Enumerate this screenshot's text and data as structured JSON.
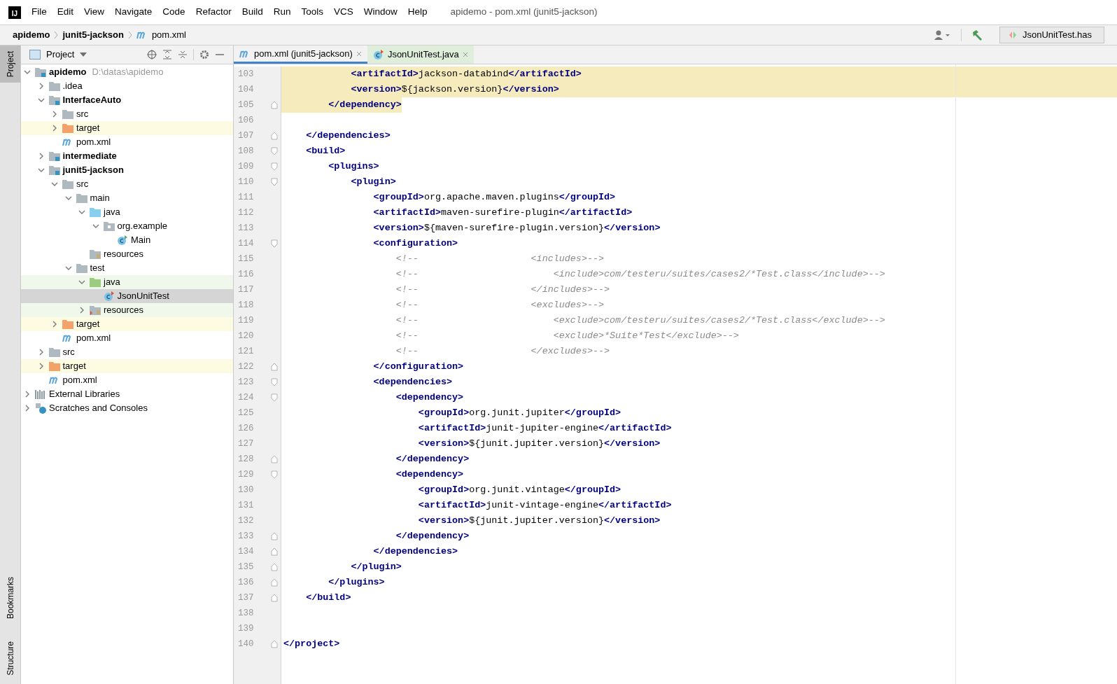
{
  "title_bar": {
    "logo": "IJ",
    "menu": [
      "File",
      "Edit",
      "View",
      "Navigate",
      "Code",
      "Refactor",
      "Build",
      "Run",
      "Tools",
      "VCS",
      "Window",
      "Help"
    ],
    "title": "apidemo - pom.xml (junit5-jackson)"
  },
  "breadcrumb": [
    {
      "label": "apidemo",
      "kind": "project"
    },
    {
      "label": "junit5-jackson",
      "kind": "module"
    },
    {
      "label": "pom.xml",
      "kind": "pom"
    }
  ],
  "run_config": {
    "label": "JsonUnitTest.has"
  },
  "side_tabs": [
    {
      "label": "Project",
      "selected": true,
      "kind": "top"
    },
    {
      "label": "Bookmarks",
      "selected": false,
      "kind": "bottom"
    },
    {
      "label": "Structure",
      "selected": false,
      "kind": "bottom"
    }
  ],
  "project_panel": {
    "title": "Project",
    "tree": [
      {
        "label": "apidemo",
        "path": "D:\\datas\\apidemo",
        "kind": "module",
        "expanded": true,
        "selected": false,
        "children": [
          {
            "label": ".idea",
            "kind": "folder",
            "expanded": false,
            "selected": false
          },
          {
            "label": "InterfaceAuto",
            "kind": "module",
            "expanded": true,
            "selected": false,
            "children": [
              {
                "label": "src",
                "kind": "folder",
                "expanded": false,
                "selected": false
              },
              {
                "label": "target",
                "kind": "excluded",
                "expanded": false,
                "selected": false
              },
              {
                "label": "pom.xml",
                "kind": "pom",
                "selected": false
              }
            ]
          },
          {
            "label": "intermediate",
            "kind": "module",
            "expanded": false,
            "selected": false
          },
          {
            "label": "junit5-jackson",
            "kind": "module",
            "expanded": true,
            "selected": false,
            "children": [
              {
                "label": "src",
                "kind": "folder",
                "expanded": true,
                "selected": false,
                "children": [
                  {
                    "label": "main",
                    "kind": "folder",
                    "expanded": true,
                    "selected": false,
                    "children": [
                      {
                        "label": "java",
                        "kind": "source",
                        "expanded": true,
                        "selected": false,
                        "children": [
                          {
                            "label": "org.example",
                            "kind": "package",
                            "expanded": true,
                            "selected": false,
                            "children": [
                              {
                                "label": "Main",
                                "kind": "class",
                                "selected": false
                              }
                            ]
                          }
                        ]
                      },
                      {
                        "label": "resources",
                        "kind": "resources",
                        "selected": false
                      }
                    ]
                  },
                  {
                    "label": "test",
                    "kind": "folder",
                    "expanded": true,
                    "selected": false,
                    "children": [
                      {
                        "label": "java",
                        "kind": "test-source",
                        "expanded": true,
                        "selected": false,
                        "children": [
                          {
                            "label": "JsonUnitTest",
                            "kind": "test-class",
                            "selected": true
                          }
                        ]
                      },
                      {
                        "label": "resources",
                        "kind": "test-resources",
                        "expanded": false,
                        "selected": false
                      }
                    ]
                  }
                ]
              },
              {
                "label": "target",
                "kind": "excluded",
                "expanded": false,
                "selected": false
              },
              {
                "label": "pom.xml",
                "kind": "pom",
                "selected": false
              }
            ]
          },
          {
            "label": "src",
            "kind": "folder",
            "expanded": false,
            "selected": false
          },
          {
            "label": "target",
            "kind": "excluded",
            "expanded": false,
            "selected": false
          },
          {
            "label": "pom.xml",
            "kind": "pom",
            "selected": false
          }
        ]
      },
      {
        "label": "External Libraries",
        "kind": "libraries",
        "expanded": false,
        "selected": false
      },
      {
        "label": "Scratches and Consoles",
        "kind": "scratches",
        "expanded": false,
        "selected": false
      }
    ]
  },
  "editor_tabs": [
    {
      "label": "pom.xml (junit5-jackson)",
      "kind": "pom",
      "selected": true
    },
    {
      "label": "JsonUnitTest.java",
      "kind": "test-class",
      "selected": false
    }
  ],
  "editor": {
    "lines": [
      {
        "number": "103",
        "kind": "highlight",
        "tokens": [
          {
            "kind": "tag",
            "text": "            <artifactId>"
          },
          {
            "kind": "text",
            "text": "jackson-databind"
          },
          {
            "kind": "tag",
            "text": "</artifactId>"
          }
        ]
      },
      {
        "number": "104",
        "kind": "highlight",
        "tokens": [
          {
            "kind": "tag",
            "text": "            <version>"
          },
          {
            "kind": "text",
            "text": "${jackson.version}"
          },
          {
            "kind": "tag",
            "text": "</version>"
          }
        ]
      },
      {
        "number": "105",
        "kind": "highlight-fold-end",
        "tokens": [
          {
            "kind": "tag",
            "text": "        </dependency>"
          }
        ]
      },
      {
        "number": "106",
        "kind": "plain"
      },
      {
        "number": "107",
        "kind": "fold-end",
        "tokens": [
          {
            "kind": "tag",
            "text": "    </dependencies>"
          }
        ]
      },
      {
        "number": "108",
        "kind": "fold-start",
        "tokens": [
          {
            "kind": "tag",
            "text": "    <build>"
          }
        ]
      },
      {
        "number": "109",
        "kind": "fold-start",
        "tokens": [
          {
            "kind": "tag",
            "text": "        <plugins>"
          }
        ]
      },
      {
        "number": "110",
        "kind": "fold-start",
        "tokens": [
          {
            "kind": "tag",
            "text": "            <plugin>"
          }
        ]
      },
      {
        "number": "111",
        "kind": "plain",
        "tokens": [
          {
            "kind": "tag",
            "text": "                <groupId>"
          },
          {
            "kind": "text",
            "text": "org.apache.maven.plugins"
          },
          {
            "kind": "tag",
            "text": "</groupId>"
          }
        ]
      },
      {
        "number": "112",
        "kind": "plain",
        "tokens": [
          {
            "kind": "tag",
            "text": "                <artifactId>"
          },
          {
            "kind": "text",
            "text": "maven-surefire-plugin"
          },
          {
            "kind": "tag",
            "text": "</artifactId>"
          }
        ]
      },
      {
        "number": "113",
        "kind": "plain",
        "tokens": [
          {
            "kind": "tag",
            "text": "                <version>"
          },
          {
            "kind": "text",
            "text": "${maven-surefire-plugin.version}"
          },
          {
            "kind": "tag",
            "text": "</version>"
          }
        ]
      },
      {
        "number": "114",
        "kind": "fold-start",
        "tokens": [
          {
            "kind": "tag",
            "text": "                <configuration>"
          }
        ]
      },
      {
        "number": "115",
        "kind": "plain",
        "tokens": [
          {
            "kind": "comment",
            "text": "                    <!--                    <includes>-->"
          }
        ]
      },
      {
        "number": "116",
        "kind": "plain",
        "tokens": [
          {
            "kind": "comment",
            "text": "                    <!--                        <include>com/testeru/suites/cases2/*Test.class</include>-->"
          }
        ]
      },
      {
        "number": "117",
        "kind": "plain",
        "tokens": [
          {
            "kind": "comment",
            "text": "                    <!--                    </includes>-->"
          }
        ]
      },
      {
        "number": "118",
        "kind": "plain",
        "tokens": [
          {
            "kind": "comment",
            "text": "                    <!--                    <excludes>-->"
          }
        ]
      },
      {
        "number": "119",
        "kind": "plain",
        "tokens": [
          {
            "kind": "comment",
            "text": "                    <!--                        <exclude>com/testeru/suites/cases2/*Test.class</exclude>-->"
          }
        ]
      },
      {
        "number": "120",
        "kind": "plain",
        "tokens": [
          {
            "kind": "comment",
            "text": "                    <!--                        <exclude>*Suite*Test</exclude>-->"
          }
        ]
      },
      {
        "number": "121",
        "kind": "plain",
        "tokens": [
          {
            "kind": "comment",
            "text": "                    <!--                    </excludes>-->"
          }
        ]
      },
      {
        "number": "122",
        "kind": "fold-end",
        "tokens": [
          {
            "kind": "tag",
            "text": "                </configuration>"
          }
        ]
      },
      {
        "number": "123",
        "kind": "fold-start",
        "tokens": [
          {
            "kind": "tag",
            "text": "                <dependencies>"
          }
        ]
      },
      {
        "number": "124",
        "kind": "fold-start",
        "tokens": [
          {
            "kind": "tag",
            "text": "                    <dependency>"
          }
        ]
      },
      {
        "number": "125",
        "kind": "plain",
        "tokens": [
          {
            "kind": "tag",
            "text": "                        <groupId>"
          },
          {
            "kind": "text",
            "text": "org.junit.jupiter"
          },
          {
            "kind": "tag",
            "text": "</groupId>"
          }
        ]
      },
      {
        "number": "126",
        "kind": "plain",
        "tokens": [
          {
            "kind": "tag",
            "text": "                        <artifactId>"
          },
          {
            "kind": "text",
            "text": "junit-jupiter-engine"
          },
          {
            "kind": "tag",
            "text": "</artifactId>"
          }
        ]
      },
      {
        "number": "127",
        "kind": "plain",
        "tokens": [
          {
            "kind": "tag",
            "text": "                        <version>"
          },
          {
            "kind": "text",
            "text": "${junit.jupiter.version}"
          },
          {
            "kind": "tag",
            "text": "</version>"
          }
        ]
      },
      {
        "number": "128",
        "kind": "fold-end",
        "tokens": [
          {
            "kind": "tag",
            "text": "                    </dependency>"
          }
        ]
      },
      {
        "number": "129",
        "kind": "fold-start",
        "tokens": [
          {
            "kind": "tag",
            "text": "                    <dependency>"
          }
        ]
      },
      {
        "number": "130",
        "kind": "plain",
        "tokens": [
          {
            "kind": "tag",
            "text": "                        <groupId>"
          },
          {
            "kind": "text",
            "text": "org.junit.vintage"
          },
          {
            "kind": "tag",
            "text": "</groupId>"
          }
        ]
      },
      {
        "number": "131",
        "kind": "plain",
        "tokens": [
          {
            "kind": "tag",
            "text": "                        <artifactId>"
          },
          {
            "kind": "text",
            "text": "junit-vintage-engine"
          },
          {
            "kind": "tag",
            "text": "</artifactId>"
          }
        ]
      },
      {
        "number": "132",
        "kind": "plain",
        "tokens": [
          {
            "kind": "tag",
            "text": "                        <version>"
          },
          {
            "kind": "text",
            "text": "${junit.jupiter.version}"
          },
          {
            "kind": "tag",
            "text": "</version>"
          }
        ]
      },
      {
        "number": "133",
        "kind": "fold-end",
        "tokens": [
          {
            "kind": "tag",
            "text": "                    </dependency>"
          }
        ]
      },
      {
        "number": "134",
        "kind": "fold-end",
        "tokens": [
          {
            "kind": "tag",
            "text": "                </dependencies>"
          }
        ]
      },
      {
        "number": "135",
        "kind": "fold-end",
        "tokens": [
          {
            "kind": "tag",
            "text": "            </plugin>"
          }
        ]
      },
      {
        "number": "136",
        "kind": "fold-end",
        "tokens": [
          {
            "kind": "tag",
            "text": "        </plugins>"
          }
        ]
      },
      {
        "number": "137",
        "kind": "fold-end",
        "tokens": [
          {
            "kind": "tag",
            "text": "    </build>"
          }
        ]
      },
      {
        "number": "138",
        "kind": "plain"
      },
      {
        "number": "139",
        "kind": "plain"
      },
      {
        "number": "140",
        "kind": "fold-end",
        "tokens": [
          {
            "kind": "tag",
            "text": "</project>"
          }
        ]
      }
    ]
  }
}
